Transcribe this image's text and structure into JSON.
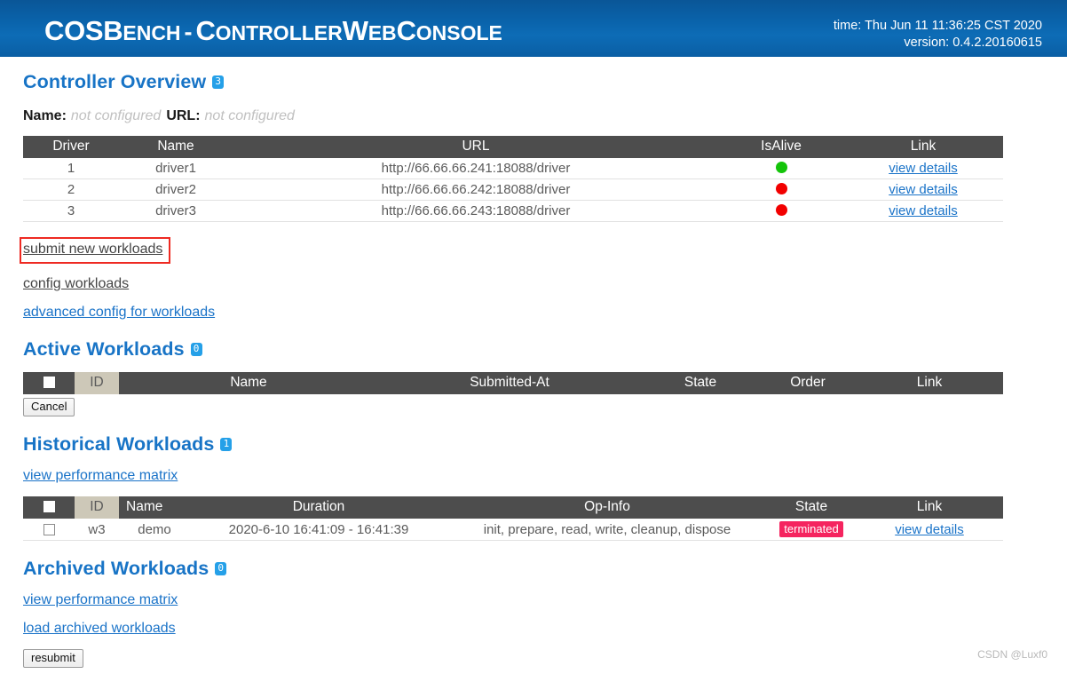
{
  "header": {
    "brand_bold": "COSB",
    "brand_small": "ENCH",
    "dash": "-",
    "subtitle_parts": [
      "C",
      "ONTROLLER",
      " W",
      "EB",
      " C",
      "ONSOLE"
    ],
    "subtitle_c1": "C",
    "subtitle_rest1": "ONTROLLER",
    "subtitle_c2": "W",
    "subtitle_rest2": "EB",
    "subtitle_c3": "C",
    "subtitle_rest3": "ONSOLE",
    "time": "time: Thu Jun 11 11:36:25 CST 2020",
    "version": "version: 0.4.2.20160615",
    "bg_color": "#0a63ab"
  },
  "controller_overview": {
    "title": "Controller Overview",
    "badge": "3",
    "name_label": "Name:",
    "name_value": "not configured",
    "url_label": "URL:",
    "url_value": "not configured",
    "table": {
      "columns": [
        "Driver",
        "Name",
        "URL",
        "IsAlive",
        "Link"
      ],
      "rows": [
        {
          "driver": "1",
          "name": "driver1",
          "url": "http://66.66.66.241:18088/driver",
          "isalive": "alive",
          "link": "view details"
        },
        {
          "driver": "2",
          "name": "driver2",
          "url": "http://66.66.66.242:18088/driver",
          "isalive": "dead",
          "link": "view details"
        },
        {
          "driver": "3",
          "name": "driver3",
          "url": "http://66.66.66.243:18088/driver",
          "isalive": "dead",
          "link": "view details"
        }
      ]
    },
    "links": [
      {
        "label": "submit new workloads",
        "style": "dark",
        "highlighted": true
      },
      {
        "label": "config workloads",
        "style": "dark",
        "highlighted": false
      },
      {
        "label": "advanced config for workloads",
        "style": "blue",
        "highlighted": false
      }
    ]
  },
  "active_workloads": {
    "title": "Active Workloads",
    "badge": "0",
    "columns": [
      "",
      "ID",
      "Name",
      "Submitted-At",
      "State",
      "Order",
      "Link"
    ],
    "rows": [],
    "cancel_label": "Cancel"
  },
  "historical_workloads": {
    "title": "Historical Workloads",
    "badge": "1",
    "matrix_link": "view performance matrix",
    "columns": [
      "",
      "ID",
      "Name",
      "Duration",
      "Op-Info",
      "State",
      "Link"
    ],
    "rows": [
      {
        "checked": false,
        "id": "w3",
        "name": "demo",
        "duration": "2020-6-10 16:41:09 - 16:41:39",
        "op_info": "init, prepare, read, write, cleanup, dispose",
        "state": "terminated",
        "state_color": "#f5245f",
        "link": "view details"
      }
    ]
  },
  "archived_workloads": {
    "title": "Archived Workloads",
    "badge": "0",
    "matrix_link": "view performance matrix",
    "load_link": "load archived workloads",
    "resubmit_label": "resubmit"
  },
  "watermark": "CSDN @Luxf0",
  "colors": {
    "header_blue": "#0a63ab",
    "section_blue": "#1874c6",
    "table_header_gray": "#4d4d4d",
    "sorted_col": "#cdc8b8",
    "alive_green": "#14c40a",
    "dead_red": "#f20000",
    "badge_blue": "#25a0e8",
    "highlight_red": "#ee2a22"
  }
}
